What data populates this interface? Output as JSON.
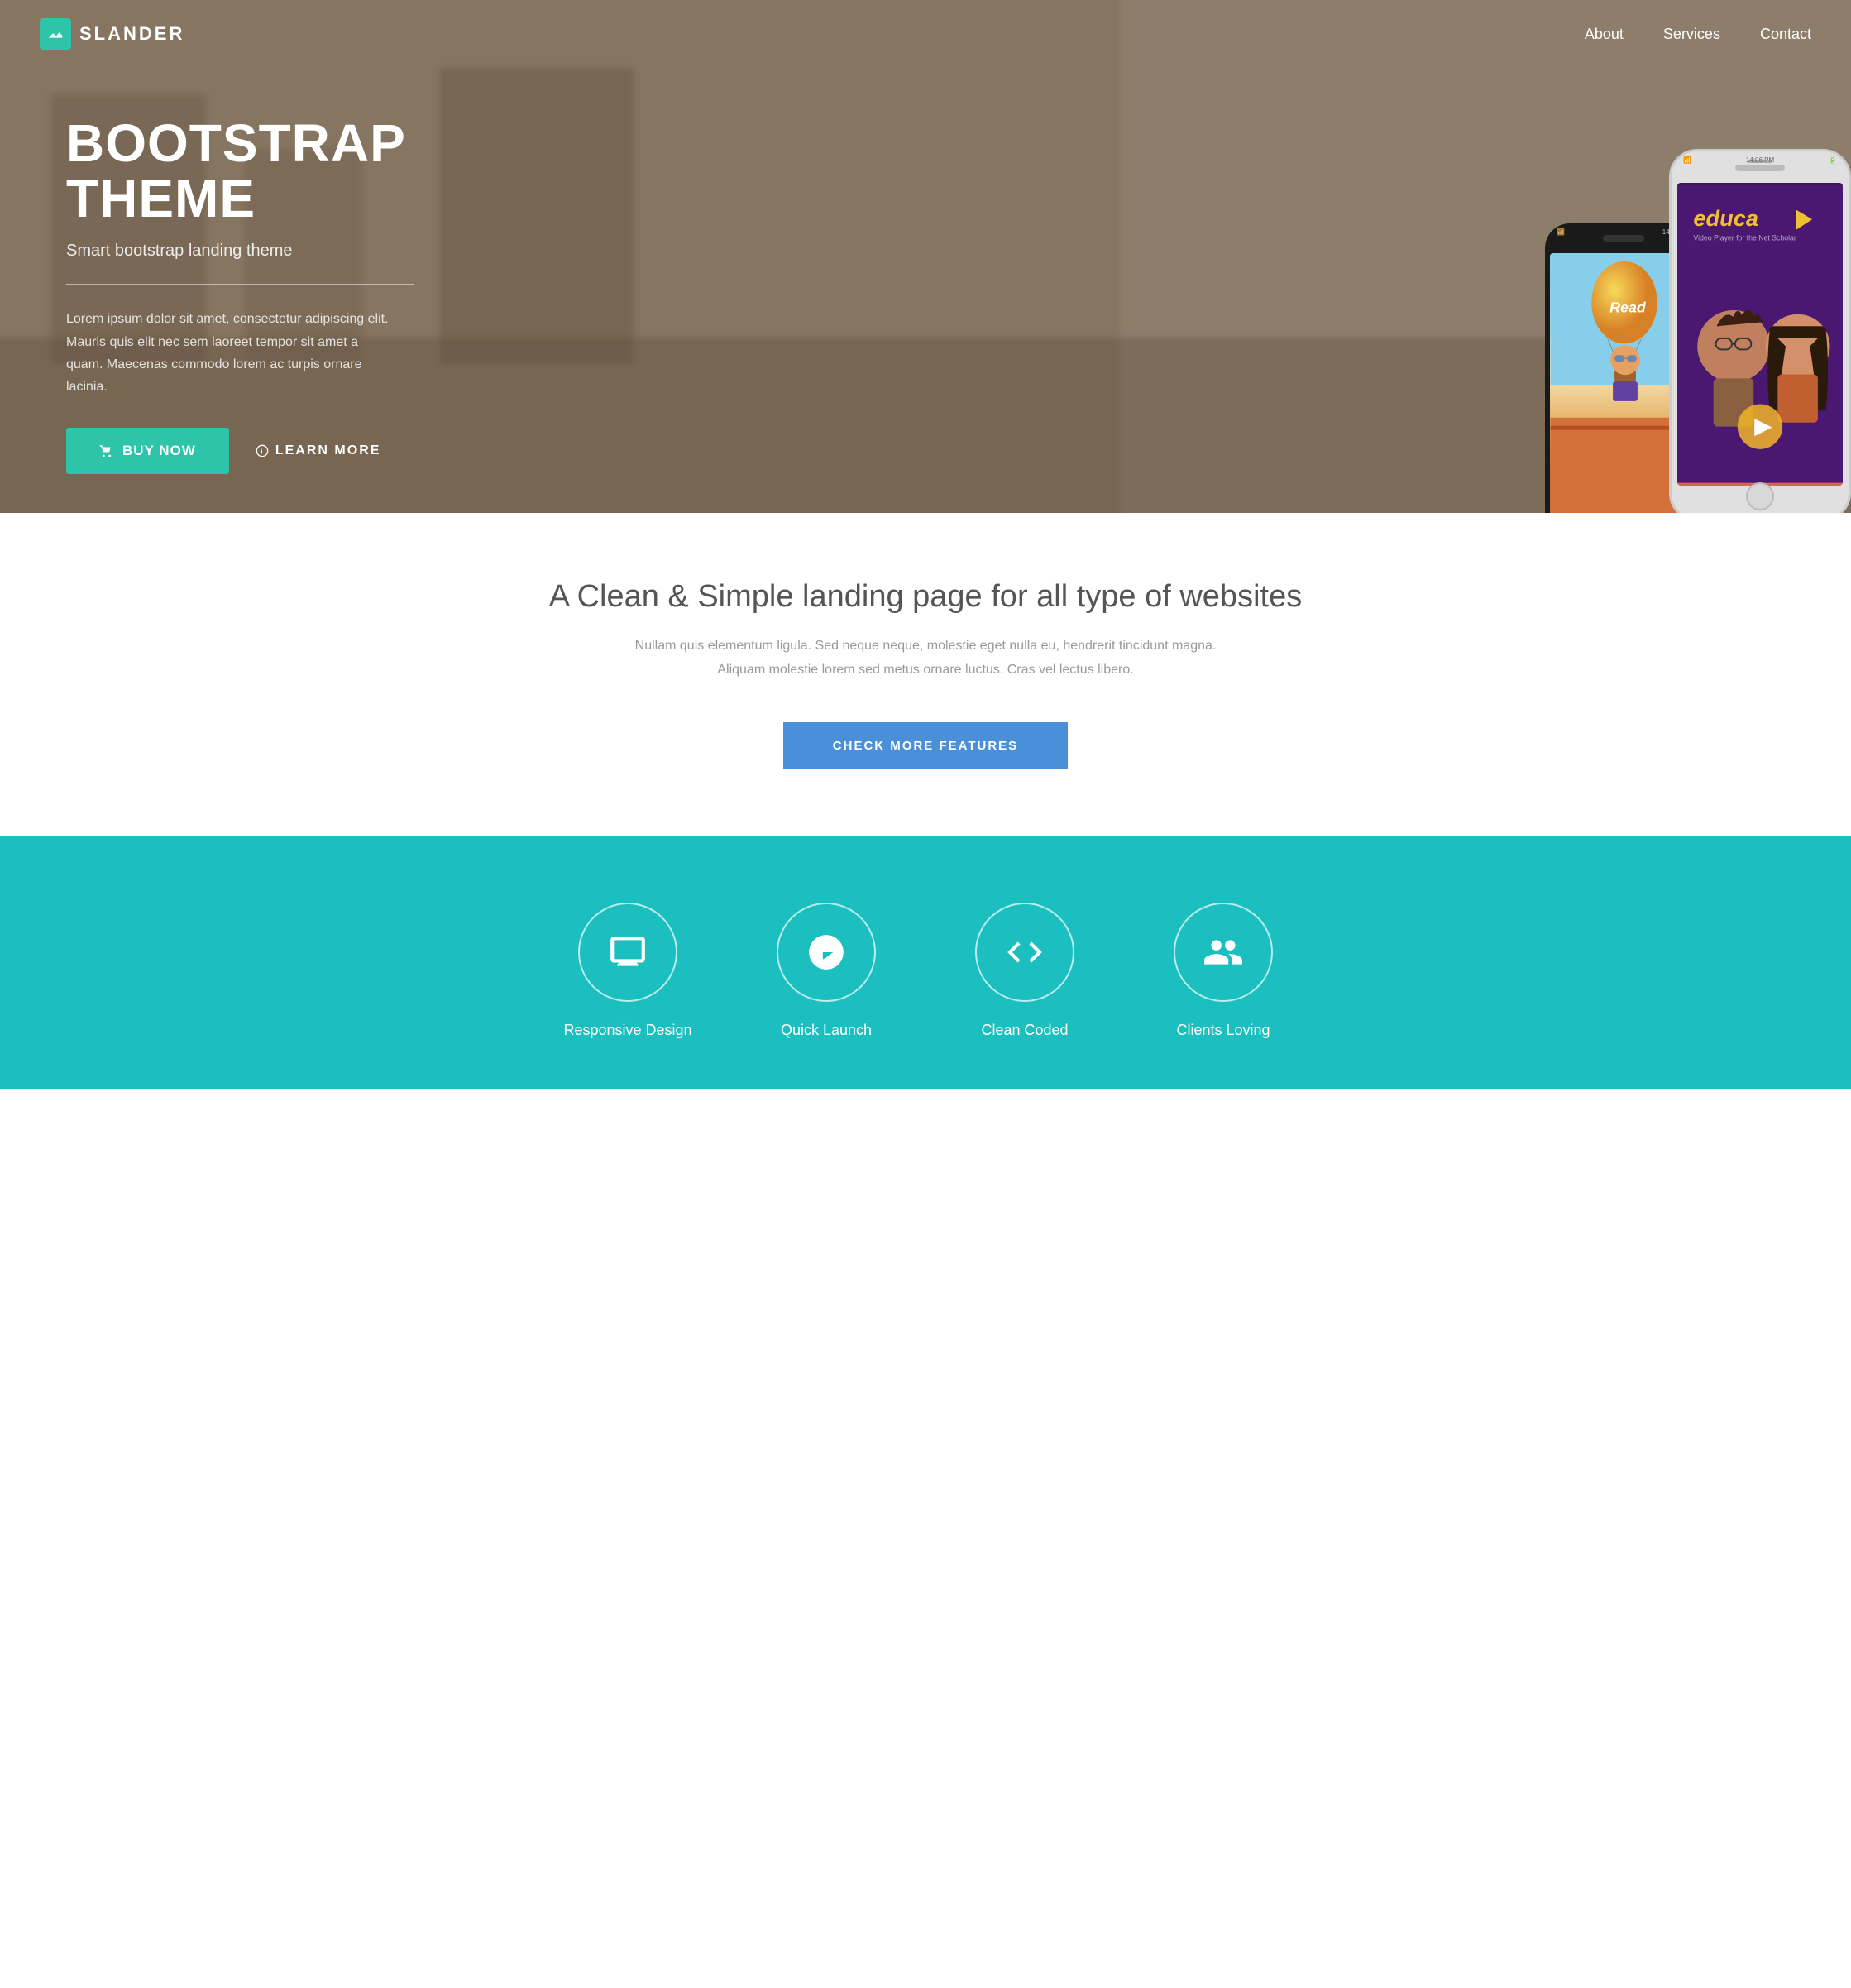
{
  "nav": {
    "logo_text": "SLANDER",
    "links": [
      {
        "label": "About",
        "id": "about"
      },
      {
        "label": "Services",
        "id": "services"
      },
      {
        "label": "Contact",
        "id": "contact"
      }
    ]
  },
  "hero": {
    "title_line1": "BOOTSTRAP",
    "title_line2": "THEME",
    "subtitle": "Smart bootstrap landing theme",
    "description": "Lorem ipsum dolor sit amet, consectetur adipiscing elit. Mauris quis elit nec sem laoreet tempor sit amet a quam. Maecenas commodo lorem ac turpis ornare lacinia.",
    "btn_buy": "BUY NOW",
    "btn_learn": "LEARN MORE"
  },
  "features_section": {
    "title": "A Clean & Simple landing page for all type of websites",
    "description": "Nullam quis elementum ligula. Sed neque neque, molestie eget nulla eu, hendrerit tincidunt magna. Aliquam molestie lorem sed metus ornare luctus. Cras vel lectus libero.",
    "btn_check": "CHECK MORE FEATURES"
  },
  "teal_section": {
    "features": [
      {
        "label": "Responsive Design",
        "icon": "monitor"
      },
      {
        "label": "Quick Launch",
        "icon": "rocket"
      },
      {
        "label": "Clean Coded",
        "icon": "code"
      },
      {
        "label": "Clients Loving",
        "icon": "users"
      }
    ]
  }
}
